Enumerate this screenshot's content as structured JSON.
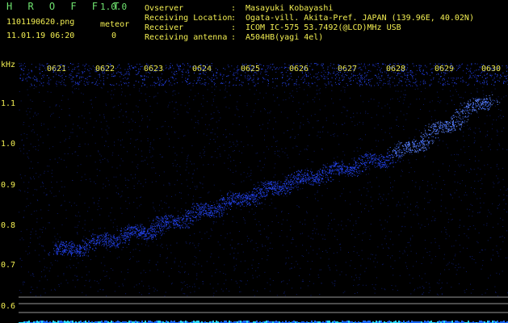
{
  "header": {
    "app_title": "H R O F F T",
    "app_version": "1.0.0",
    "file_name": "1101190620.png",
    "datetime": "11.01.19 06:20",
    "meteor_label": "meteor",
    "meteor_count": "0",
    "info": [
      {
        "key": "Ovserver",
        "value": "Masayuki Kobayashi"
      },
      {
        "key": "Receiving Location",
        "value": "Ogata-vill. Akita-Pref. JAPAN (139.96E, 40.02N)"
      },
      {
        "key": "Receiver",
        "value": "ICOM IC-575 53.7492(@LCD)MHz USB"
      },
      {
        "key": "Receiving antenna",
        "value": "A504HB(yagi 4el)"
      }
    ],
    "separator": ":"
  },
  "colors": {
    "label_green": "#6fe36f",
    "label_yellow": "#f2ee52",
    "signal_blue": "#2a4cff",
    "background": "#000000"
  },
  "chart_data": {
    "type": "spectrogram",
    "y_unit": "kHz",
    "y_ticks": [
      "1.1",
      "1.0",
      "0.9",
      "0.8",
      "0.7",
      "0.6"
    ],
    "x_ticks": [
      "0621",
      "0622",
      "0623",
      "0624",
      "0625",
      "0626",
      "0627",
      "0628",
      "0629",
      "0630"
    ],
    "trace": {
      "x": [
        "0621",
        "0622",
        "0623",
        "0624",
        "0625",
        "0626",
        "0627",
        "0628",
        "0629",
        "0630"
      ],
      "freq_khz": [
        0.73,
        0.76,
        0.79,
        0.83,
        0.87,
        0.91,
        0.94,
        0.97,
        1.04,
        1.12
      ]
    }
  }
}
